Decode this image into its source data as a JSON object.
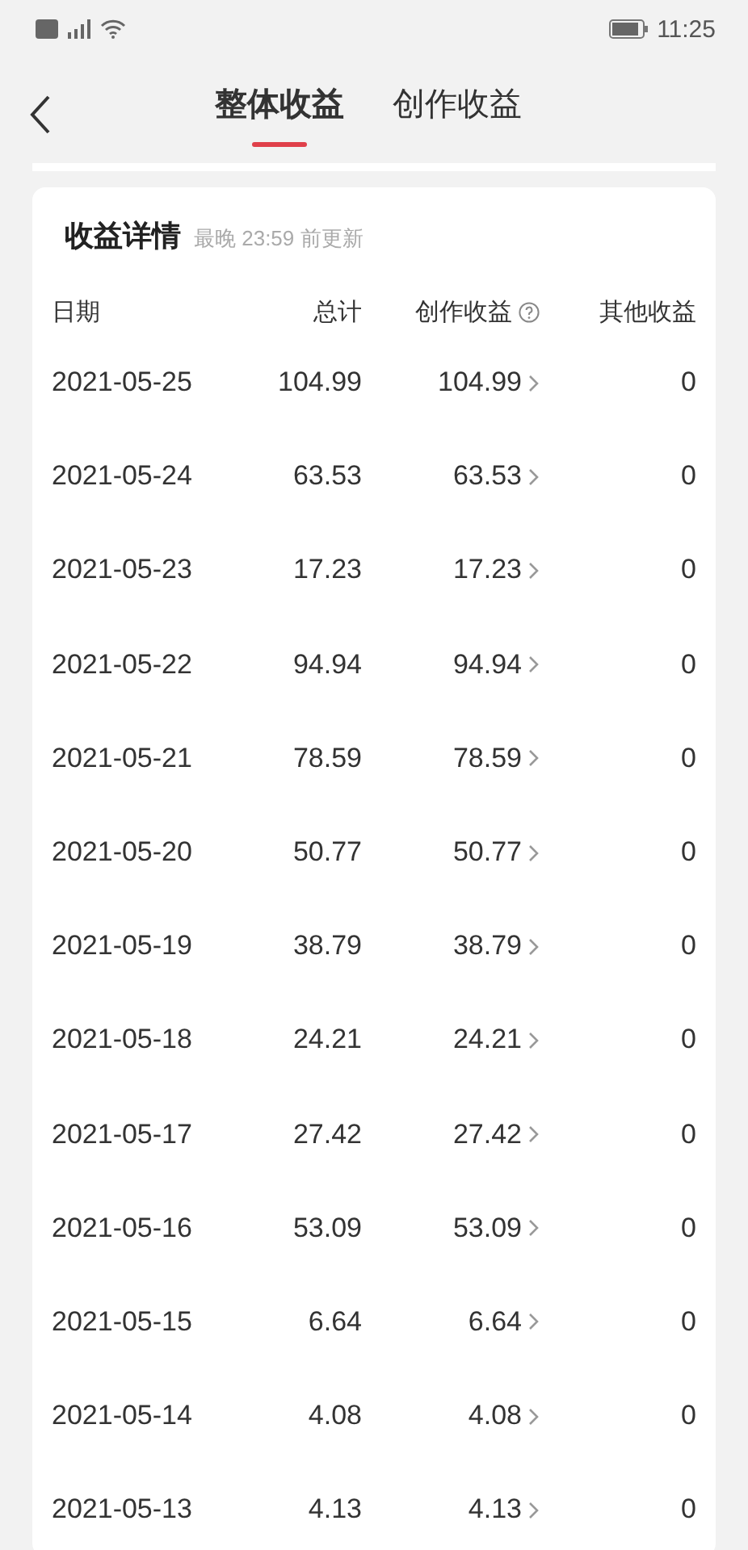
{
  "status_bar": {
    "time": "11:25"
  },
  "tabs": [
    {
      "label": "整体收益",
      "selected": true
    },
    {
      "label": "创作收益",
      "selected": false
    }
  ],
  "card": {
    "title": "收益详情",
    "subtitle": "最晚 23:59 前更新"
  },
  "table": {
    "columns": [
      "日期",
      "总计",
      "创作收益",
      "其他收益"
    ],
    "rows": [
      {
        "date": "2021-05-25",
        "total": "104.99",
        "creation": "104.99",
        "other": "0"
      },
      {
        "date": "2021-05-24",
        "total": "63.53",
        "creation": "63.53",
        "other": "0"
      },
      {
        "date": "2021-05-23",
        "total": "17.23",
        "creation": "17.23",
        "other": "0"
      },
      {
        "date": "2021-05-22",
        "total": "94.94",
        "creation": "94.94",
        "other": "0"
      },
      {
        "date": "2021-05-21",
        "total": "78.59",
        "creation": "78.59",
        "other": "0"
      },
      {
        "date": "2021-05-20",
        "total": "50.77",
        "creation": "50.77",
        "other": "0"
      },
      {
        "date": "2021-05-19",
        "total": "38.79",
        "creation": "38.79",
        "other": "0"
      },
      {
        "date": "2021-05-18",
        "total": "24.21",
        "creation": "24.21",
        "other": "0"
      },
      {
        "date": "2021-05-17",
        "total": "27.42",
        "creation": "27.42",
        "other": "0"
      },
      {
        "date": "2021-05-16",
        "total": "53.09",
        "creation": "53.09",
        "other": "0"
      },
      {
        "date": "2021-05-15",
        "total": "6.64",
        "creation": "6.64",
        "other": "0"
      },
      {
        "date": "2021-05-14",
        "total": "4.08",
        "creation": "4.08",
        "other": "0"
      },
      {
        "date": "2021-05-13",
        "total": "4.13",
        "creation": "4.13",
        "other": "0"
      }
    ]
  }
}
